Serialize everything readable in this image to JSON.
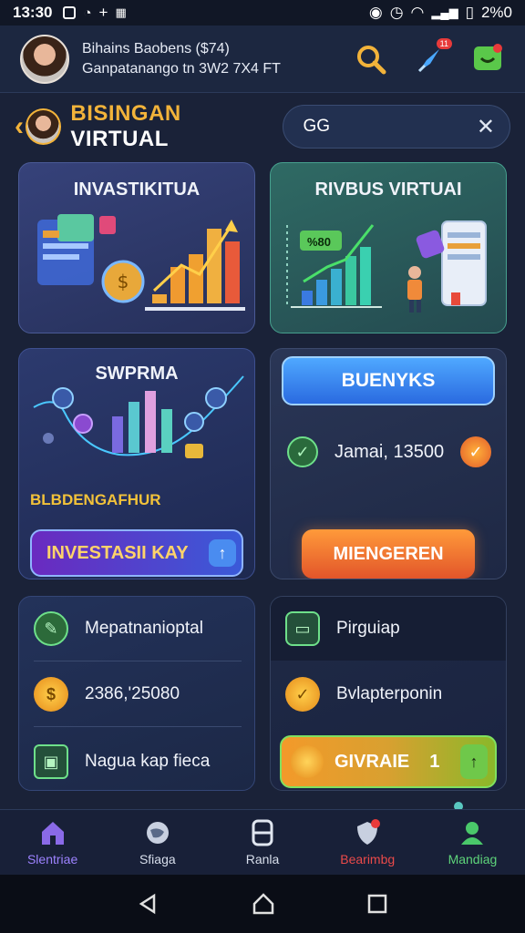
{
  "status": {
    "time": "13:30",
    "battery": "2%0"
  },
  "header": {
    "user_name": "Bihains Baobens ($74)",
    "user_sub": "Ganpatanango tn 3W2 7X4 FT",
    "notif_badge": "11"
  },
  "subheader": {
    "title_a": "BISINGAN",
    "title_b": "VIRTUAL",
    "search_value": "GG"
  },
  "cards": {
    "c1_title": "INVASTIKITUA",
    "c2_title": "RIVBUS VIRTUAI",
    "c2_chart_label": "%80",
    "c3_title": "SWPRMA",
    "c3_promo": "BLBDENGAFHUR",
    "c3_button": "INVESTASII KAY",
    "c4_button": "BUENYKS",
    "c4_amount": "Jamai, 13500",
    "c4_action": "MIENGEREN",
    "c5_row1": "Mepatnanioptal",
    "c5_row2": "2386,'25080",
    "c5_row3": "Nagua kap fieca",
    "c6_row1": "Pirguiap",
    "c6_row2": "Bvlapterponin",
    "c6_button": "GIVRAIE",
    "c6_button_num": "1"
  },
  "nav": [
    {
      "label": "Slentriae",
      "icon": "home-icon"
    },
    {
      "label": "Sfiaga",
      "icon": "map-icon"
    },
    {
      "label": "Ranla",
      "icon": "robot-icon"
    },
    {
      "label": "Bearimbg",
      "icon": "shield-icon",
      "badge": "0"
    },
    {
      "label": "Mandiag",
      "icon": "user-group-icon"
    }
  ]
}
